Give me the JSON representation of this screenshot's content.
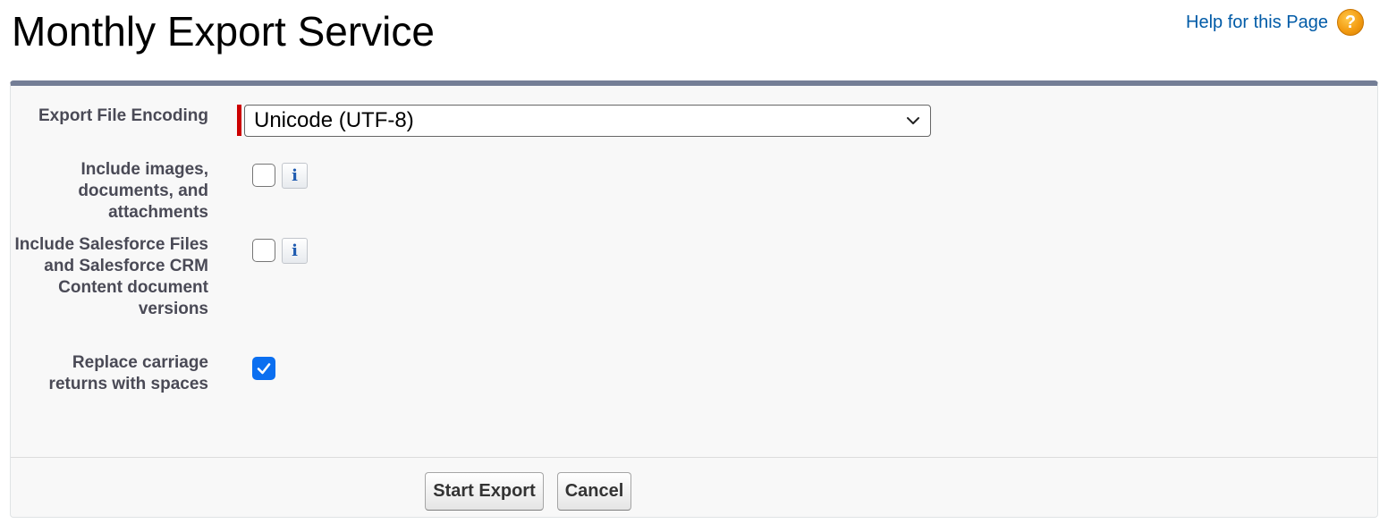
{
  "header": {
    "title": "Monthly Export Service",
    "help_link": "Help for this Page",
    "help_icon": "question-icon",
    "help_icon_glyph": "?"
  },
  "form": {
    "encoding": {
      "label": "Export File Encoding",
      "selected": "Unicode (UTF-8)",
      "required": true
    },
    "include_images": {
      "label": "Include images, documents, and attachments",
      "checked": false,
      "info_glyph": "i"
    },
    "include_files": {
      "label": "Include Salesforce Files and Salesforce CRM Content document versions",
      "checked": false,
      "info_glyph": "i"
    },
    "replace_returns": {
      "label": "Replace carriage returns with spaces",
      "checked": true
    }
  },
  "buttons": {
    "start": "Start Export",
    "cancel": "Cancel"
  },
  "colors": {
    "accent": "#0b6ff0",
    "required": "#cc0000",
    "link": "#015ba7",
    "panel_border": "#747e96"
  }
}
